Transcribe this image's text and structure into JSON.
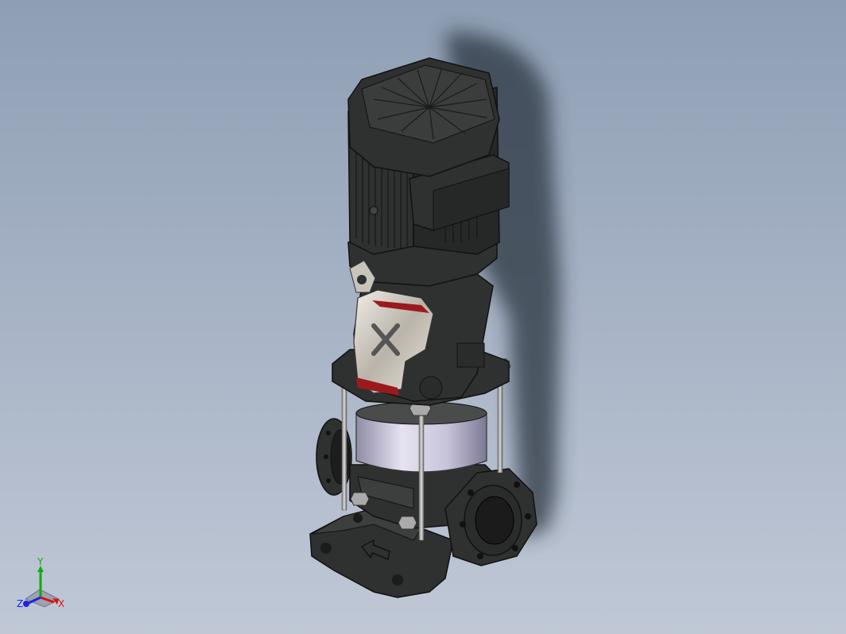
{
  "viewport": {
    "background_top": "#8e9fb4",
    "background_bottom": "#c0c8d6"
  },
  "model": {
    "colors": {
      "body": "#2f3130",
      "body_light": "#3c3f3d",
      "edge": "#111111",
      "accent_red": "#9a1a1e",
      "steel_sleeve": "#c9c6dc",
      "chrome": "#d7d2c9"
    }
  },
  "triad": {
    "x_label": "X",
    "y_label": "Y",
    "z_label": "Z",
    "x_color": "#d11",
    "y_color": "#1a1",
    "z_color": "#22d"
  }
}
